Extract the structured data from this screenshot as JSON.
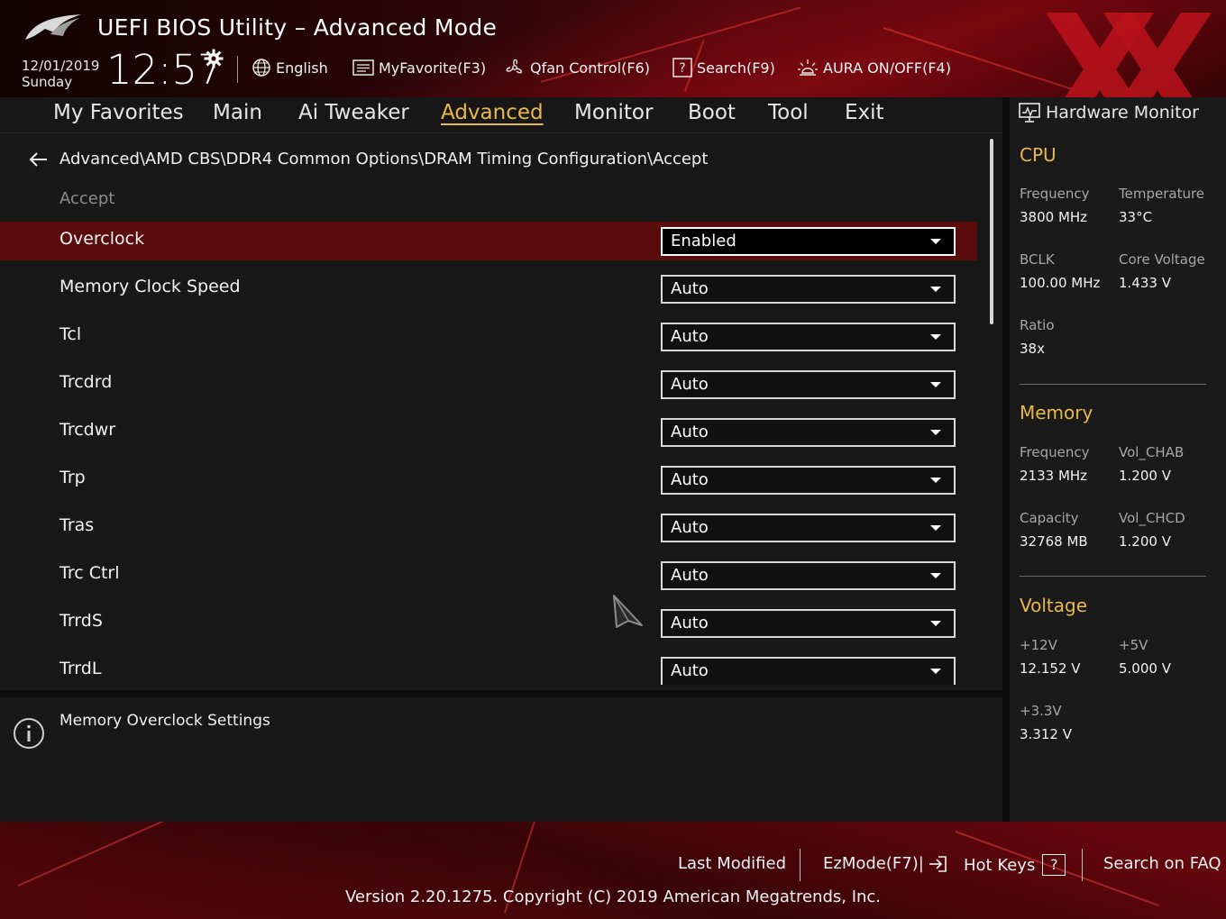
{
  "header": {
    "title": "UEFI BIOS Utility – Advanced Mode",
    "date": "12/01/2019",
    "day": "Sunday",
    "time": "12:57",
    "language": "English",
    "my_favorite": "MyFavorite(F3)",
    "qfan": "Qfan Control(F6)",
    "search": "Search(F9)",
    "aura": "AURA ON/OFF(F4)"
  },
  "menu": {
    "items": [
      "My Favorites",
      "Main",
      "Ai Tweaker",
      "Advanced",
      "Monitor",
      "Boot",
      "Tool",
      "Exit"
    ],
    "active": "Advanced"
  },
  "main": {
    "breadcrumb": "Advanced\\AMD CBS\\DDR4 Common Options\\DRAM Timing Configuration\\Accept",
    "section_label": "Accept",
    "settings": [
      {
        "label": "Overclock",
        "value": "Enabled",
        "selected": true
      },
      {
        "label": "Memory Clock Speed",
        "value": "Auto"
      },
      {
        "label": "Tcl",
        "value": "Auto"
      },
      {
        "label": "Trcdrd",
        "value": "Auto"
      },
      {
        "label": "Trcdwr",
        "value": "Auto"
      },
      {
        "label": "Trp",
        "value": "Auto"
      },
      {
        "label": "Tras",
        "value": "Auto"
      },
      {
        "label": "Trc Ctrl",
        "value": "Auto"
      },
      {
        "label": "TrrdS",
        "value": "Auto"
      },
      {
        "label": "TrrdL",
        "value": "Auto"
      }
    ]
  },
  "help": {
    "text": "Memory Overclock Settings"
  },
  "hardware_monitor": {
    "title": "Hardware Monitor",
    "cpu": {
      "heading": "CPU",
      "frequency_label": "Frequency",
      "frequency": "3800 MHz",
      "temperature_label": "Temperature",
      "temperature": "33°C",
      "bclk_label": "BCLK",
      "bclk": "100.00 MHz",
      "core_voltage_label": "Core Voltage",
      "core_voltage": "1.433 V",
      "ratio_label": "Ratio",
      "ratio": "38x"
    },
    "memory": {
      "heading": "Memory",
      "frequency_label": "Frequency",
      "frequency": "2133 MHz",
      "vol_chab_label": "Vol_CHAB",
      "vol_chab": "1.200 V",
      "capacity_label": "Capacity",
      "capacity": "32768 MB",
      "vol_chcd_label": "Vol_CHCD",
      "vol_chcd": "1.200 V"
    },
    "voltage": {
      "heading": "Voltage",
      "v12_label": "+12V",
      "v12": "12.152 V",
      "v5_label": "+5V",
      "v5": "5.000 V",
      "v33_label": "+3.3V",
      "v33": "3.312 V"
    }
  },
  "footer": {
    "last_modified": "Last Modified",
    "ezmode": "EzMode(F7)|",
    "hot_keys": "Hot Keys",
    "hot_keys_badge": "?",
    "search_faq": "Search on FAQ",
    "copyright": "Version 2.20.1275. Copyright (C) 2019 American Megatrends, Inc."
  },
  "colors": {
    "accent": "#e8b84d",
    "selected_row": "#5a0c0c",
    "panel": "#181818",
    "header_red": "#4a070b"
  },
  "icons": [
    "rog-logo",
    "gear-icon",
    "globe-icon",
    "list-icon",
    "fan-icon",
    "help-icon",
    "aura-icon",
    "back-arrow-icon",
    "dropdown-caret-icon",
    "mouse-cursor-icon",
    "info-icon",
    "monitor-icon",
    "exit-arrow-icon"
  ]
}
